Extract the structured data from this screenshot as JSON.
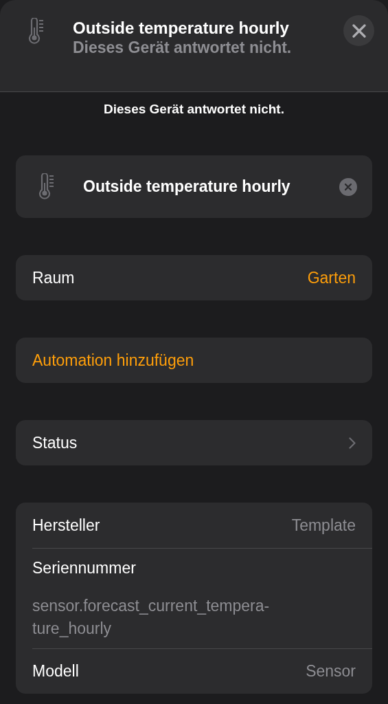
{
  "header": {
    "title": "Outside temperature hourly",
    "subtitle": "Dieses Gerät antwortet nicht."
  },
  "status_message": "Dieses Gerät antwortet nicht.",
  "name_field": {
    "value": "Outside temperature hourly"
  },
  "sections": [
    {
      "rows": [
        {
          "kind": "value",
          "label": "Raum",
          "value": "Garten"
        }
      ]
    },
    {
      "rows": [
        {
          "kind": "action",
          "label": "Automation hinzufügen"
        }
      ]
    },
    {
      "rows": [
        {
          "kind": "nav",
          "label": "Status"
        }
      ]
    },
    {
      "rows": [
        {
          "kind": "value",
          "label": "Hersteller",
          "value": "Template"
        },
        {
          "kind": "stacked",
          "label": "Seriennummer",
          "lines": [
            "sensor.forecast_current_tempera-",
            "ture_hourly"
          ]
        },
        {
          "kind": "value",
          "label": "Modell",
          "value": "Sensor"
        }
      ]
    }
  ]
}
